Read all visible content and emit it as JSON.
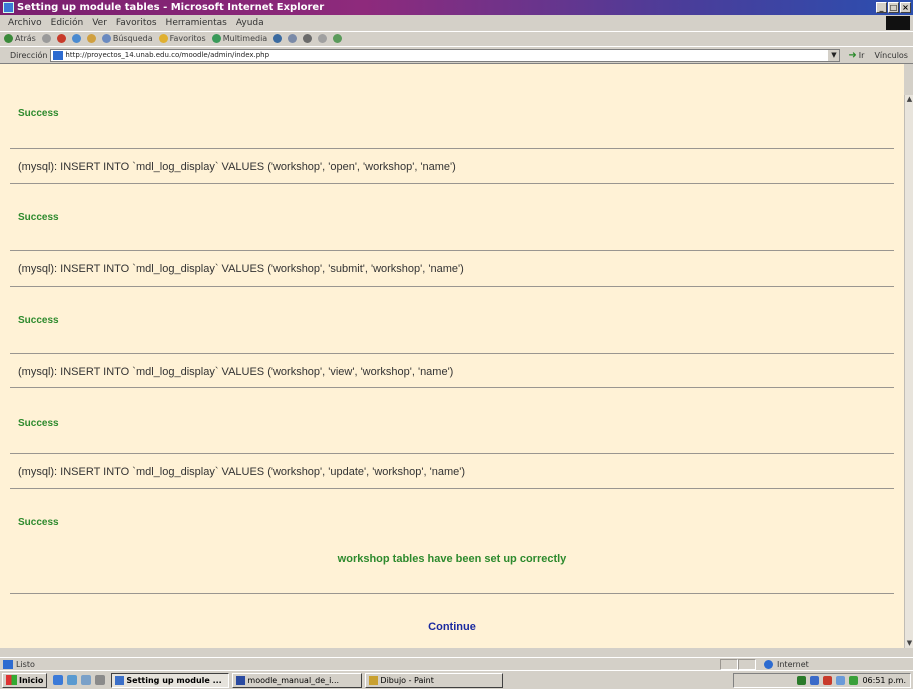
{
  "window": {
    "title": "Setting up module tables - Microsoft Internet Explorer",
    "controls": [
      "_",
      "□",
      "×"
    ]
  },
  "menu": [
    "Archivo",
    "Edición",
    "Ver",
    "Favoritos",
    "Herramientas",
    "Ayuda"
  ],
  "toolbar": {
    "back_label": "Atrás",
    "search_label": "Búsqueda",
    "favorites_label": "Favoritos",
    "media_label": "Multimedia"
  },
  "address": {
    "label": "Dirección",
    "url": "http://proyectos_14.unab.edu.co/moodle/admin/index.php",
    "go_label": "Ir",
    "links_label": "Vínculos"
  },
  "page": {
    "blocks": [
      {
        "success": "Success",
        "sql": "(mysql): INSERT INTO `mdl_log_display` VALUES ('workshop', 'open', 'workshop', 'name')"
      },
      {
        "success": "Success",
        "sql": "(mysql): INSERT INTO `mdl_log_display` VALUES ('workshop', 'submit', 'workshop', 'name')"
      },
      {
        "success": "Success",
        "sql": "(mysql): INSERT INTO `mdl_log_display` VALUES ('workshop', 'view', 'workshop', 'name')"
      },
      {
        "success": "Success",
        "sql": "(mysql): INSERT INTO `mdl_log_display` VALUES ('workshop', 'update', 'workshop', 'name')"
      }
    ],
    "final_success": "Success",
    "summary": "workshop tables have been set up correctly",
    "continue_label": "Continue"
  },
  "status": {
    "text": "Listo",
    "zone": "Internet"
  },
  "taskbar": {
    "start_label": "Inicio",
    "tasks": [
      "Setting up module ...",
      "moodle_manual_de_i...",
      "Dibujo - Paint"
    ],
    "clock": "06:51 p.m."
  }
}
